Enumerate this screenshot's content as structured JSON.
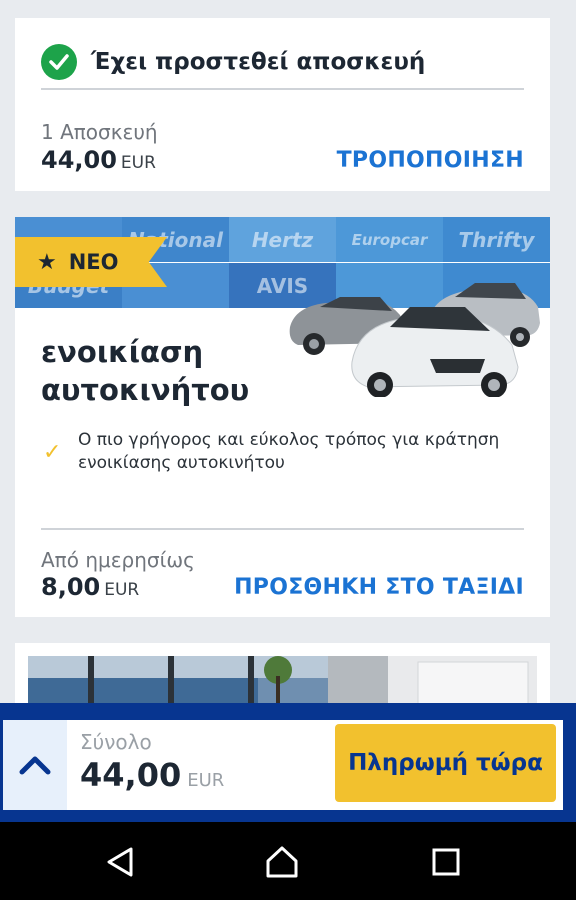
{
  "baggage": {
    "title": "Έχει προστεθεί αποσκευή",
    "count_label": "1 Αποσκευή",
    "price_value": "44,00",
    "currency": "EUR",
    "action_label": "ΤΡΟΠΟΠΟΙΗΣΗ",
    "check_icon": "check-circle-icon"
  },
  "car_rental": {
    "badge_label": "ΝΕΟ",
    "badge_icon": "star-icon",
    "brands": [
      "Hertz",
      "Europcar",
      "Thrifty",
      "National",
      "AVIS",
      "Budget"
    ],
    "title": "ενοικίαση αυτοκινήτου",
    "feature_text": "Ο πιο γρήγορος και εύκολος τρόπος για κράτηση ενοικίασης αυτοκινήτου",
    "from_label": "Από ημερησίως",
    "price_value": "8,00",
    "currency": "EUR",
    "action_label": "ΠΡΟΣΘΗΚΗ ΣΤΟ ΤΑΞΙΔΙ"
  },
  "bottom_bar": {
    "total_label": "Σύνολο",
    "total_value": "44,00",
    "currency": "EUR",
    "pay_label": "Πληρωμή τώρα",
    "expand_icon": "chevron-up-icon"
  },
  "colors": {
    "brand_blue": "#073590",
    "link_blue": "#1b73d3",
    "accent_yellow": "#f2c12e",
    "success_green": "#1da34a"
  }
}
